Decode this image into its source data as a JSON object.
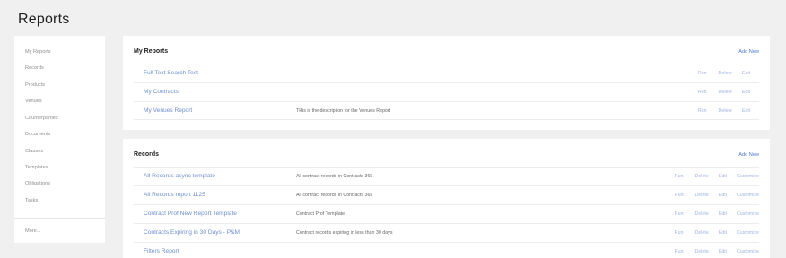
{
  "page": {
    "title": "Reports"
  },
  "sidebar": {
    "items": [
      {
        "label": "My Reports"
      },
      {
        "label": "Records"
      },
      {
        "label": "Products"
      },
      {
        "label": "Venues"
      },
      {
        "label": "Counterparties"
      },
      {
        "label": "Documents"
      },
      {
        "label": "Clauses"
      },
      {
        "label": "Templates"
      },
      {
        "label": "Obligations"
      },
      {
        "label": "Tasks"
      }
    ],
    "more_label": "More..."
  },
  "my_reports": {
    "title": "My Reports",
    "add_new_label": "Add New",
    "rows": [
      {
        "name": "Full Text Search Test",
        "description": "",
        "actions": [
          "Run",
          "Delete",
          "Edit"
        ]
      },
      {
        "name": "My Contracts",
        "description": "",
        "actions": [
          "Run",
          "Delete",
          "Edit"
        ]
      },
      {
        "name": "My Venues Report",
        "description": "THis is the description for the Venues Report",
        "actions": [
          "Run",
          "Delete",
          "Edit"
        ]
      }
    ]
  },
  "records": {
    "title": "Records",
    "add_new_label": "Add New",
    "rows": [
      {
        "name": "All Records async template",
        "description": "All contract records in Contracts 365",
        "actions": [
          "Run",
          "Delete",
          "Edit",
          "Customize"
        ]
      },
      {
        "name": "All Records report 1125",
        "description": "All contract records in Contracts 365",
        "actions": [
          "Run",
          "Delete",
          "Edit",
          "Customize"
        ]
      },
      {
        "name": "Contract Prof New Report Template",
        "description": "Contract Prof Template",
        "actions": [
          "Run",
          "Delete",
          "Edit",
          "Customize"
        ]
      },
      {
        "name": "Contracts Expiring in 30 Days - P&M",
        "description": "Contract records expiring in less than 30 days",
        "actions": [
          "Run",
          "Delete",
          "Edit",
          "Customize"
        ]
      },
      {
        "name": "Filters Report",
        "description": "",
        "actions": [
          "Run",
          "Delete",
          "Edit",
          "Customize"
        ]
      }
    ]
  }
}
